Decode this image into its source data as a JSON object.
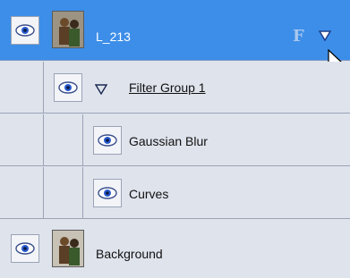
{
  "layers": {
    "top": {
      "name": "L_213",
      "badge": "F",
      "selected_color": "#3d8ee8"
    },
    "group": {
      "name": "Filter Group 1"
    },
    "filters": [
      {
        "name": "Gaussian Blur"
      },
      {
        "name": "Curves"
      }
    ],
    "background": {
      "name": "Background"
    }
  },
  "icons": {
    "visibility": "eye-icon",
    "disclosure": "triangle-down-icon",
    "menu": "triangle-down-icon",
    "cursor": "arrow-cursor-icon"
  }
}
